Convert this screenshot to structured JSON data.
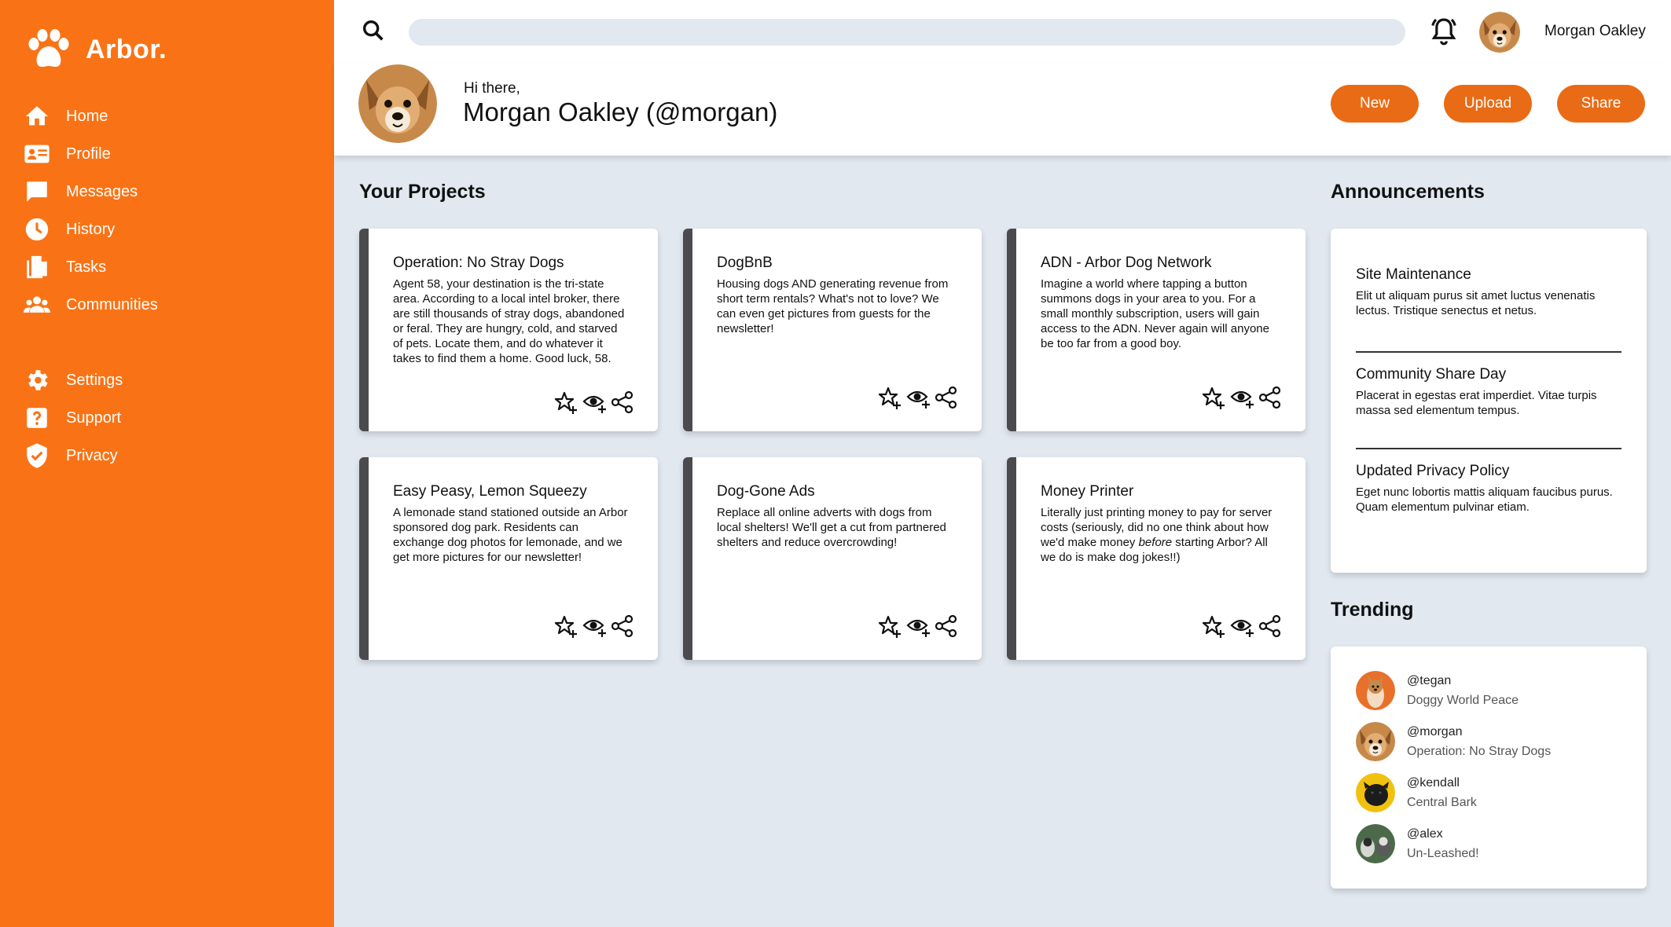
{
  "app": {
    "name": "Arbor."
  },
  "sidebar": {
    "items": [
      {
        "label": "Home",
        "icon": "home-icon"
      },
      {
        "label": "Profile",
        "icon": "profile-card-icon"
      },
      {
        "label": "Messages",
        "icon": "message-icon"
      },
      {
        "label": "History",
        "icon": "clock-icon"
      },
      {
        "label": "Tasks",
        "icon": "documents-icon"
      },
      {
        "label": "Communities",
        "icon": "people-icon"
      }
    ],
    "secondary": [
      {
        "label": "Settings",
        "icon": "gear-icon"
      },
      {
        "label": "Support",
        "icon": "help-icon"
      },
      {
        "label": "Privacy",
        "icon": "shield-icon"
      }
    ]
  },
  "topbar": {
    "search_placeholder": "",
    "username": "Morgan Oakley"
  },
  "header": {
    "greeting": "Hi there,",
    "name": "Morgan Oakley (@morgan)",
    "buttons": {
      "new": "New",
      "upload": "Upload",
      "share": "Share"
    }
  },
  "projects": {
    "title": "Your Projects",
    "items": [
      {
        "title": "Operation: No Stray Dogs",
        "desc": "Agent 58, your destination is the tri-state area. According to a local intel broker, there are still thousands of stray dogs, abandoned or feral. They are hungry, cold, and starved of pets. Locate them, and do whatever it takes to find them a home. Good luck, 58."
      },
      {
        "title": "DogBnB",
        "desc": "Housing dogs AND generating revenue from short term rentals? What's not to love? We can even get pictures from guests for the newsletter!"
      },
      {
        "title": "ADN - Arbor Dog Network",
        "desc": "Imagine a world where tapping a button summons dogs in your area to you. For a small monthly subscription, users will gain access to the ADN. Never again will anyone be too far from a good boy."
      },
      {
        "title": "Easy Peasy, Lemon Squeezy",
        "desc": "A lemonade stand stationed outside an Arbor sponsored dog park. Residents can exchange dog photos for lemonade, and we get more pictures for our newsletter!"
      },
      {
        "title": "Dog-Gone Ads",
        "desc": "Replace all online adverts with dogs from local shelters! We'll get a cut from partnered shelters and reduce overcrowding!"
      },
      {
        "title": "Money Printer",
        "desc_before": "Literally just printing money to pay for server costs (seriously, did no one think about how we'd make money ",
        "desc_em": "before",
        "desc_after": " starting Arbor? All we do is make dog jokes!!)"
      }
    ]
  },
  "announcements": {
    "title": "Announcements",
    "items": [
      {
        "title": "Site Maintenance",
        "body": "Elit ut aliquam purus sit amet luctus venenatis lectus. Tristique senectus et netus."
      },
      {
        "title": "Community Share Day",
        "body": "Placerat in egestas erat imperdiet. Vitae turpis massa sed elementum tempus."
      },
      {
        "title": "Updated Privacy Policy",
        "body": "Eget nunc lobortis mattis aliquam faucibus purus. Quam elementum pulvinar etiam."
      }
    ]
  },
  "trending": {
    "title": "Trending",
    "items": [
      {
        "handle": "@tegan",
        "project": "Doggy World Peace"
      },
      {
        "handle": "@morgan",
        "project": "Operation: No Stray Dogs"
      },
      {
        "handle": "@kendall",
        "project": "Central Bark"
      },
      {
        "handle": "@alex",
        "project": "Un-Leashed!"
      }
    ]
  },
  "colors": {
    "accent": "#f97316",
    "button": "#ea6b15",
    "background": "#e2e8f0",
    "card_border": "#4b4b4f"
  }
}
